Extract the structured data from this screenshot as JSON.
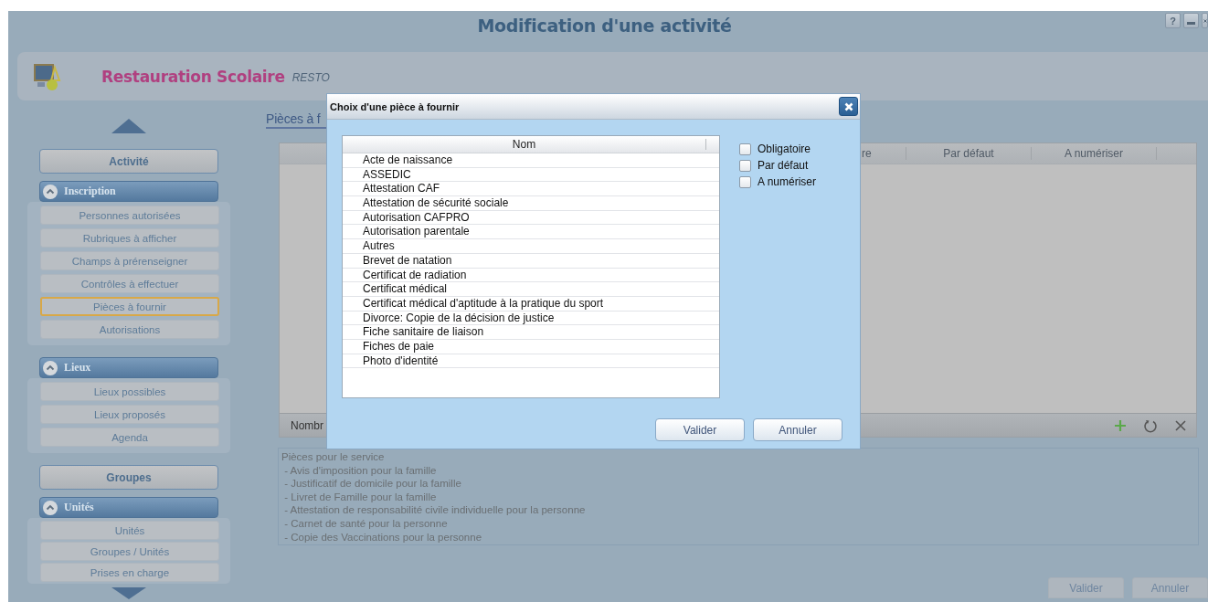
{
  "window": {
    "title": "Modification d'une activité",
    "controls": [
      {
        "kind": "help",
        "label": "?"
      },
      {
        "kind": "minimize"
      },
      {
        "kind": "close"
      }
    ]
  },
  "banner": {
    "title": "Restauration Scolaire",
    "code": "RESTO"
  },
  "sidebar": {
    "sections": [
      {
        "kind": "button",
        "label": "Activité"
      },
      {
        "kind": "group",
        "label": "Inscription",
        "expanded": true,
        "items": [
          {
            "label": "Personnes autorisées",
            "selected": false
          },
          {
            "label": "Rubriques à afficher",
            "selected": false
          },
          {
            "label": "Champs à prérenseigner",
            "selected": false
          },
          {
            "label": "Contrôles à effectuer",
            "selected": false
          },
          {
            "label": "Pièces à fournir",
            "selected": true
          },
          {
            "label": "Autorisations",
            "selected": false
          }
        ]
      },
      {
        "kind": "group",
        "label": "Lieux",
        "expanded": true,
        "items": [
          {
            "label": "Lieux possibles",
            "selected": false
          },
          {
            "label": "Lieux proposés",
            "selected": false
          },
          {
            "label": "Agenda",
            "selected": false
          }
        ]
      },
      {
        "kind": "button",
        "label": "Groupes"
      },
      {
        "kind": "group",
        "label": "Unités",
        "expanded": true,
        "items": [
          {
            "label": "Unités",
            "selected": false
          },
          {
            "label": "Groupes / Unités",
            "selected": false
          },
          {
            "label": "Prises en charge",
            "selected": false
          }
        ]
      }
    ]
  },
  "main": {
    "heading": "Pièces à f",
    "table": {
      "columns": [
        "re",
        "Par défaut",
        "A numériser"
      ],
      "footer": "Nombr"
    },
    "info": [
      "Pièces pour le service",
      " - Avis d'imposition pour la famille",
      " - Justificatif de domicile pour la famille",
      " - Livret de Famille pour la famille",
      " - Attestation de responsabilité civile individuelle pour la personne",
      " - Carnet de santé pour la personne",
      " - Copie des Vaccinations pour la personne"
    ],
    "buttons": [
      "Valider",
      "Annuler"
    ]
  },
  "dialog": {
    "title": "Choix d'une pièce à fournir",
    "column": "Nom",
    "rows": [
      {
        "label": "Acte de naissance",
        "selected": false
      },
      {
        "label": "ASSEDIC",
        "selected": false
      },
      {
        "label": "Attestation CAF",
        "selected": false
      },
      {
        "label": "Attestation de sécurité sociale",
        "selected": false
      },
      {
        "label": "Autorisation CAFPRO",
        "selected": false
      },
      {
        "label": "Autorisation parentale",
        "selected": false
      },
      {
        "label": "Autres",
        "selected": false
      },
      {
        "label": "Brevet de natation",
        "selected": false
      },
      {
        "label": "Certificat de radiation",
        "selected": false
      },
      {
        "label": "Certificat médical",
        "selected": false
      },
      {
        "label": "Certificat médical d'aptitude à la pratique du sport",
        "selected": false
      },
      {
        "label": "Divorce: Copie de la décision de justice",
        "selected": false
      },
      {
        "label": "Fiche sanitaire de liaison",
        "selected": false
      },
      {
        "label": "Fiches de paie",
        "selected": false
      },
      {
        "label": "Photo d'identité",
        "selected": false
      }
    ],
    "options": [
      {
        "label": "Obligatoire",
        "checked": false
      },
      {
        "label": "Par défaut",
        "checked": false
      },
      {
        "label": "A numériser",
        "checked": false
      }
    ],
    "buttons": [
      "Valider",
      "Annuler"
    ]
  }
}
